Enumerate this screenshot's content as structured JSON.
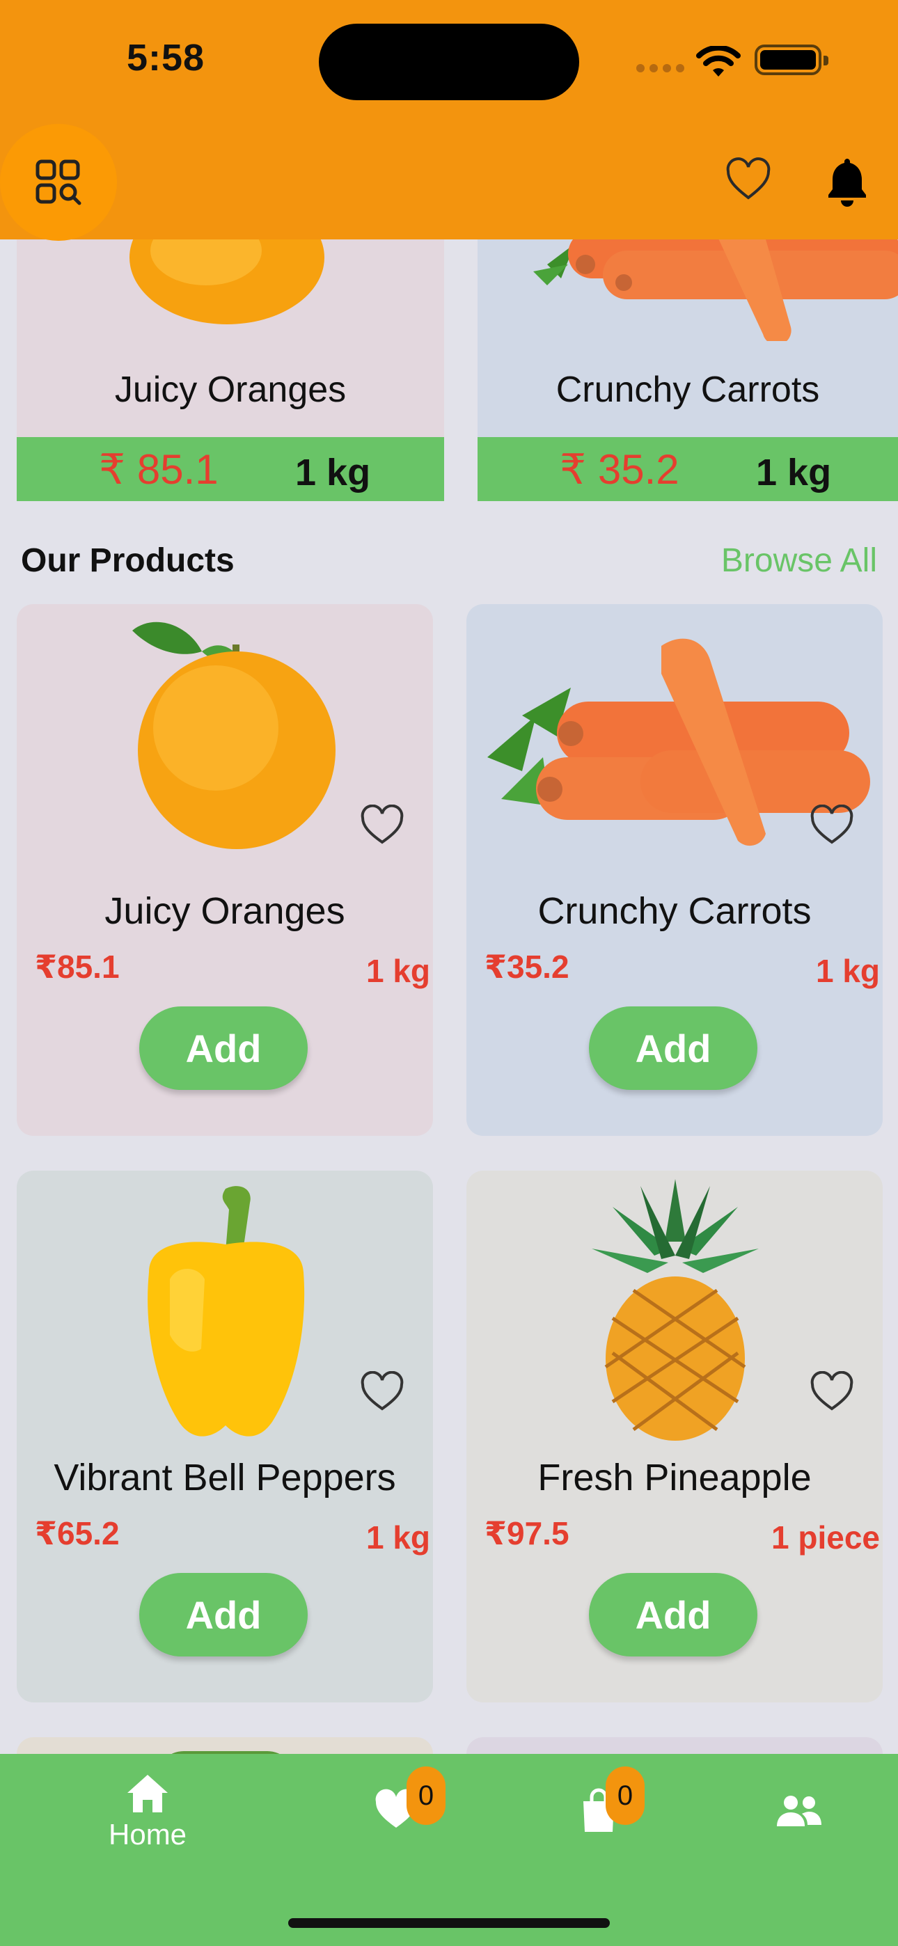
{
  "status_bar": {
    "time": "5:58"
  },
  "header": {
    "menu_icon": "grid-search-icon",
    "favorite_icon": "heart-outline-icon",
    "notification_icon": "bell-icon",
    "bg_color": "#f3940e"
  },
  "banner": [
    {
      "name": "Juicy Oranges",
      "price": "₹ 85.1",
      "unit": "1 kg"
    },
    {
      "name": "Crunchy Carrots",
      "price": "₹ 35.2",
      "unit": "1 kg"
    }
  ],
  "section": {
    "title": "Our Products",
    "browse_all": "Browse All"
  },
  "products": [
    {
      "name": "Juicy Oranges",
      "price": "₹85.1",
      "unit": "1 kg",
      "add": "Add",
      "bg": "#e3d7de"
    },
    {
      "name": "Crunchy Carrots",
      "price": "₹35.2",
      "unit": "1 kg",
      "add": "Add",
      "bg": "#d0d8e6"
    },
    {
      "name": "Vibrant Bell Peppers",
      "price": "₹65.2",
      "unit": "1 kg",
      "add": "Add",
      "bg": "#d4dadc"
    },
    {
      "name": "Fresh Pineapple",
      "price": "₹97.5",
      "unit": "1 piece",
      "add": "Add",
      "bg": "#dfdedc"
    }
  ],
  "bottom_nav": {
    "home_label": "Home",
    "favorites_count": "0",
    "cart_count": "0",
    "bg_color": "#69c467",
    "accent": "#f3940e"
  }
}
